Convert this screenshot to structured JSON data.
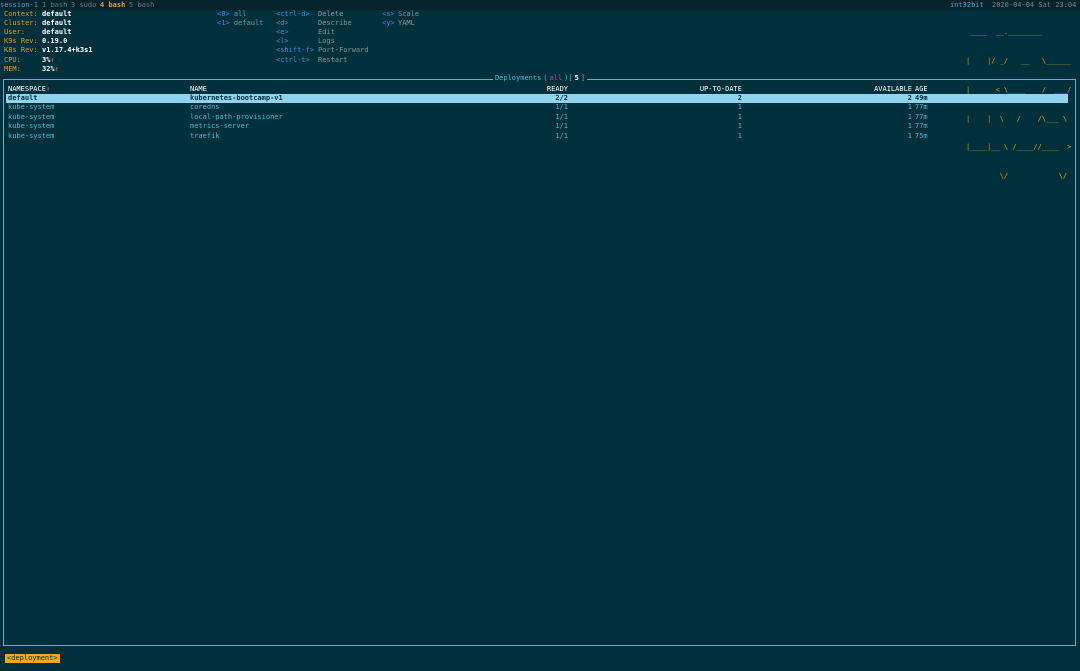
{
  "tmux": {
    "session": "session-1",
    "windows": [
      {
        "index": "1",
        "name": "bash"
      },
      {
        "index": "3",
        "name": "sudo"
      },
      {
        "index": "4",
        "name": "bash",
        "current": true
      },
      {
        "index": "5",
        "name": "bash"
      }
    ],
    "host": "int32bit",
    "datetime": "2020-04-04 Sat 23:04"
  },
  "info": {
    "context_label": "Context:",
    "context": "default",
    "cluster_label": "Cluster:",
    "cluster": "default",
    "user_label": "User:",
    "user": "default",
    "k9s_rev_label": "K9s Rev:",
    "k9s_rev": "0.19.0",
    "k8s_rev_label": "K8s Rev:",
    "k8s_rev": "v1.17.4+k3s1",
    "cpu_label": "CPU:",
    "cpu": "3%",
    "mem_label": "MEM:",
    "mem": "32%",
    "trend_up": "↑"
  },
  "namespaces": [
    {
      "key": "<0>",
      "name": "all"
    },
    {
      "key": "<1>",
      "name": "default"
    }
  ],
  "hotkeys": [
    {
      "key": "<ctrl-d>",
      "desc": "Delete"
    },
    {
      "key": "<d>",
      "desc": "Describe"
    },
    {
      "key": "<e>",
      "desc": "Edit"
    },
    {
      "key": "<l>",
      "desc": "Logs"
    },
    {
      "key": "<shift-f>",
      "desc": "Port-Forward"
    },
    {
      "key": "<ctrl-t>",
      "desc": "Restart"
    }
  ],
  "hotkeys2": [
    {
      "key": "<s>",
      "desc": "Scale"
    },
    {
      "key": "<y>",
      "desc": "YAML"
    }
  ],
  "logo_lines": [
    " ____  __.________       ",
    "|    |/ _/   __   \\______",
    "|      < \\____    /  ___/",
    "|    |  \\   /    /\\___ \\ ",
    "|____|__ \\ /____//____  >",
    "        \\/            \\/ "
  ],
  "panel": {
    "title": "Deployments",
    "scope": "all",
    "count": "5"
  },
  "table": {
    "columns": [
      "NAMESPACE",
      "NAME",
      "READY",
      "UP-TO-DATE",
      "AVAILABLE",
      "AGE"
    ],
    "sort_indicator": "↑",
    "rows": [
      {
        "namespace": "default",
        "name": "kubernetes-bootcamp-v1",
        "ready": "2/2",
        "uptodate": "2",
        "available": "2",
        "age": "49m",
        "selected": true
      },
      {
        "namespace": "kube-system",
        "name": "coredns",
        "ready": "1/1",
        "uptodate": "1",
        "available": "1",
        "age": "77m"
      },
      {
        "namespace": "kube-system",
        "name": "local-path-provisioner",
        "ready": "1/1",
        "uptodate": "1",
        "available": "1",
        "age": "77m"
      },
      {
        "namespace": "kube-system",
        "name": "metrics-server",
        "ready": "1/1",
        "uptodate": "1",
        "available": "1",
        "age": "77m"
      },
      {
        "namespace": "kube-system",
        "name": "traefik",
        "ready": "1/1",
        "uptodate": "1",
        "available": "1",
        "age": "75m"
      }
    ]
  },
  "breadcrumb": "<deployment>",
  "colors": {
    "background": "#00303c",
    "accent": "#4ab9d2",
    "label": "#e0a020",
    "selected_row": "#8fd3ef",
    "breadcrumb": "#f0a820"
  }
}
